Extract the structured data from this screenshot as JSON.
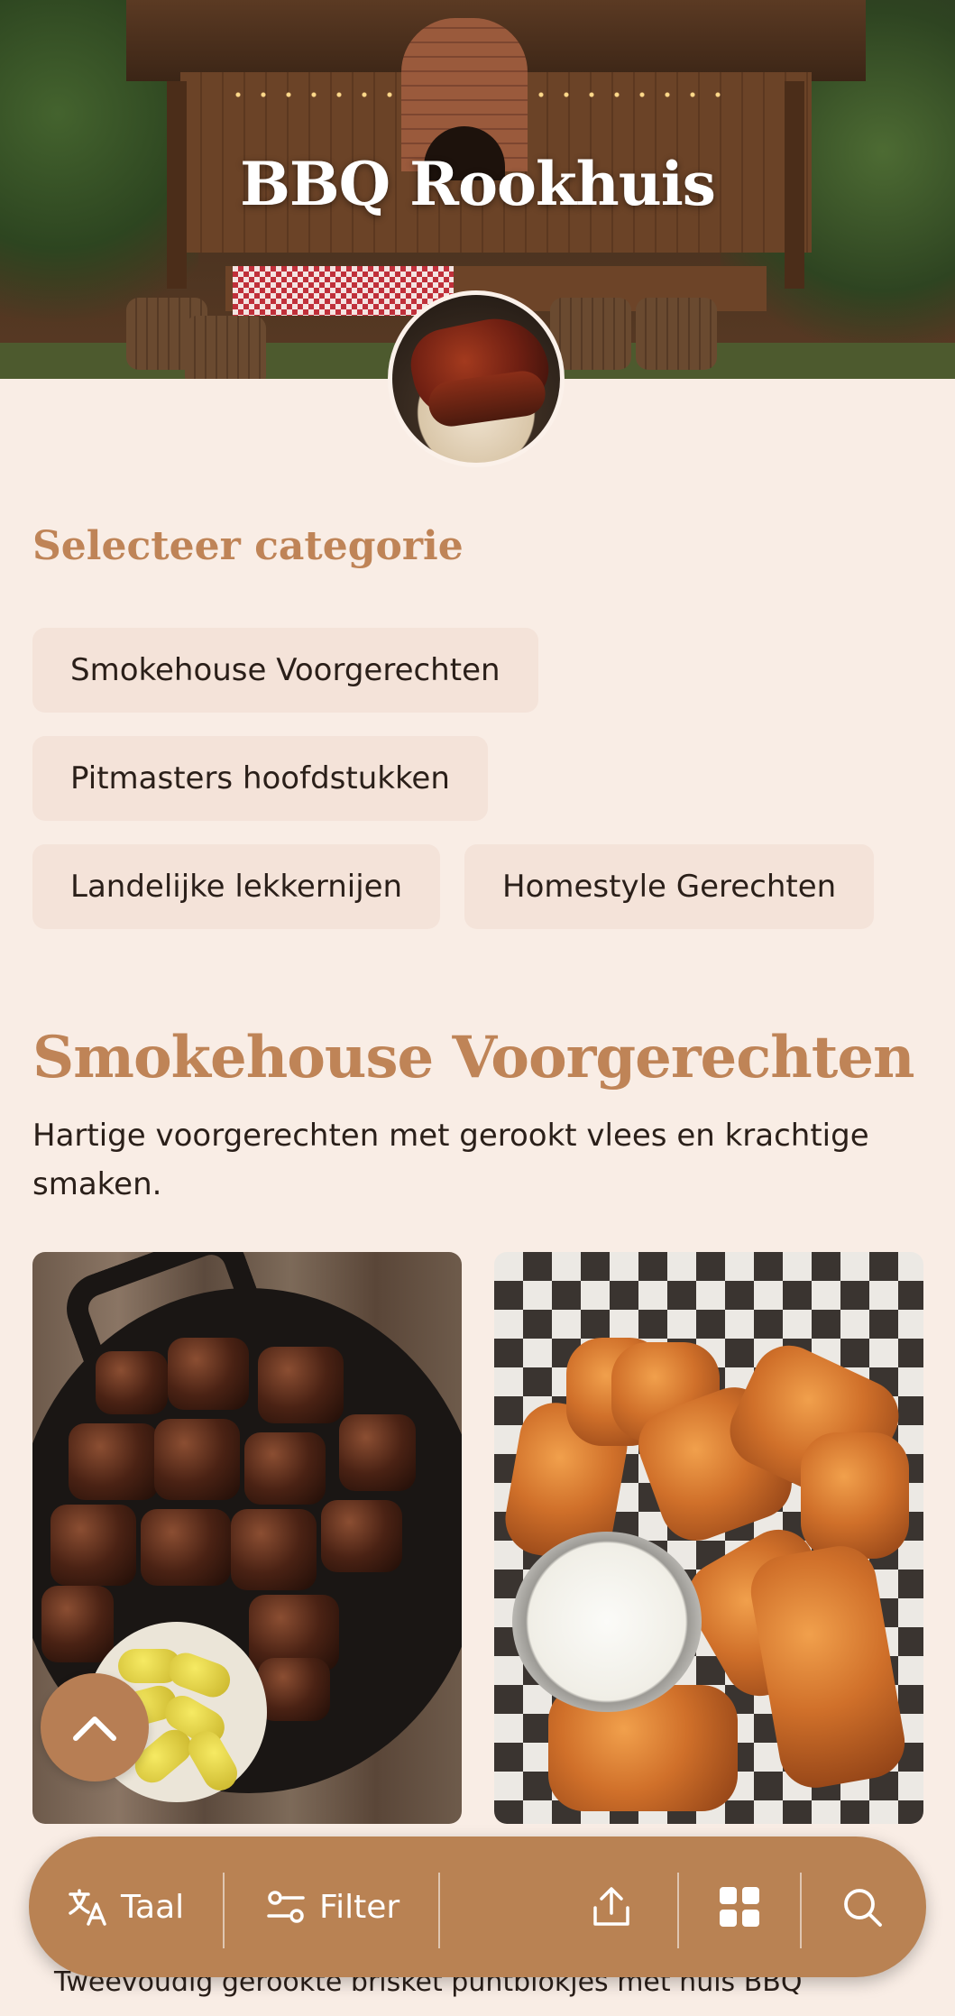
{
  "header": {
    "title": "BBQ Rookhuis"
  },
  "categories": {
    "heading": "Selecteer categorie",
    "items": [
      "Smokehouse Voorgerechten",
      "Pitmasters hoofdstukken",
      "Landelijke lekkernijen",
      "Homestyle Gerechten"
    ]
  },
  "section": {
    "title": "Smokehouse Voorgerechten",
    "description": "Hartige voorgerechten met gerookt vlees en krachtige smaken."
  },
  "products": [
    {
      "image": "burnt-ends-photo",
      "name_partial": "Tweevoudig gerookte brisket puntblokjes met huis BBQ"
    },
    {
      "image": "chicken-wings-photo",
      "name_partial": "",
      "price_partial": ""
    }
  ],
  "bottom_bar": {
    "language_label": "Taal",
    "filter_label": "Filter",
    "icons": [
      "translate-icon",
      "filter-icon",
      "share-icon",
      "grid-icon",
      "search-icon"
    ]
  },
  "colors": {
    "background": "#f9ede5",
    "accent": "#bf8457",
    "bar": "#b98253",
    "chip": "#f4e3d9"
  }
}
